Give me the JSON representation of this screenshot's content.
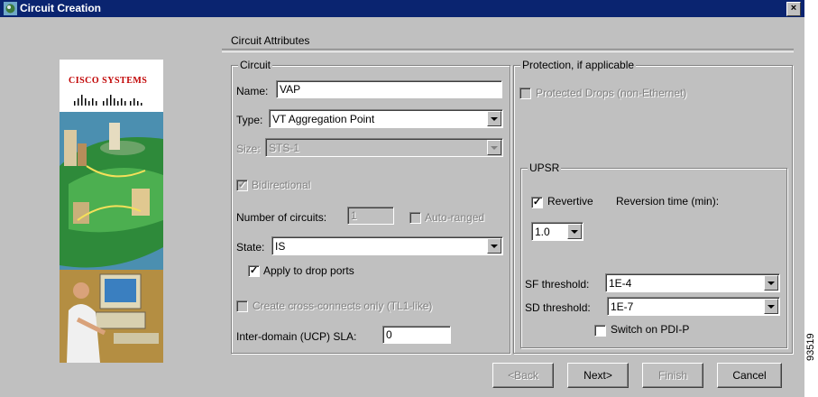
{
  "window": {
    "title": "Circuit Creation",
    "close_glyph": "×"
  },
  "logo": {
    "brand": "CISCO SYSTEMS"
  },
  "section": {
    "title": "Circuit Attributes"
  },
  "circuit": {
    "legend": "Circuit",
    "name_label": "Name:",
    "name_value": "VAP",
    "type_label": "Type:",
    "type_value": "VT Aggregation Point",
    "size_label": "Size:",
    "size_value": "STS-1",
    "bidirectional_label": "Bidirectional",
    "bidirectional_checked": true,
    "num_circuits_label": "Number of circuits:",
    "num_circuits_value": "1",
    "auto_ranged_label": "Auto-ranged",
    "auto_ranged_checked": false,
    "state_label": "State:",
    "state_value": "IS",
    "apply_drop_label": "Apply to drop ports",
    "apply_drop_checked": true,
    "cross_connects_label": "Create cross-connects only (TL1-like)",
    "cross_connects_checked": false,
    "sla_label": "Inter-domain (UCP) SLA:",
    "sla_value": "0"
  },
  "protection": {
    "legend": "Protection, if applicable",
    "protected_drops_label": "Protected Drops (non-Ethernet)",
    "protected_drops_checked": false
  },
  "upsr": {
    "legend": "UPSR",
    "revertive_label": "Revertive",
    "revertive_checked": true,
    "reversion_time_label": "Reversion time (min):",
    "reversion_time_value": "1.0",
    "sf_label": "SF threshold:",
    "sf_value": "1E-4",
    "sd_label": "SD threshold:",
    "sd_value": "1E-7",
    "switch_pdi_label": "Switch on PDI-P",
    "switch_pdi_checked": false
  },
  "buttons": {
    "back": "<Back",
    "next": "Next>",
    "finish": "Finish",
    "cancel": "Cancel"
  },
  "figure_id": "93519",
  "colors": {
    "titlebar": "#0a2470",
    "face": "#c0c0c0",
    "brand_red": "#c00000"
  }
}
